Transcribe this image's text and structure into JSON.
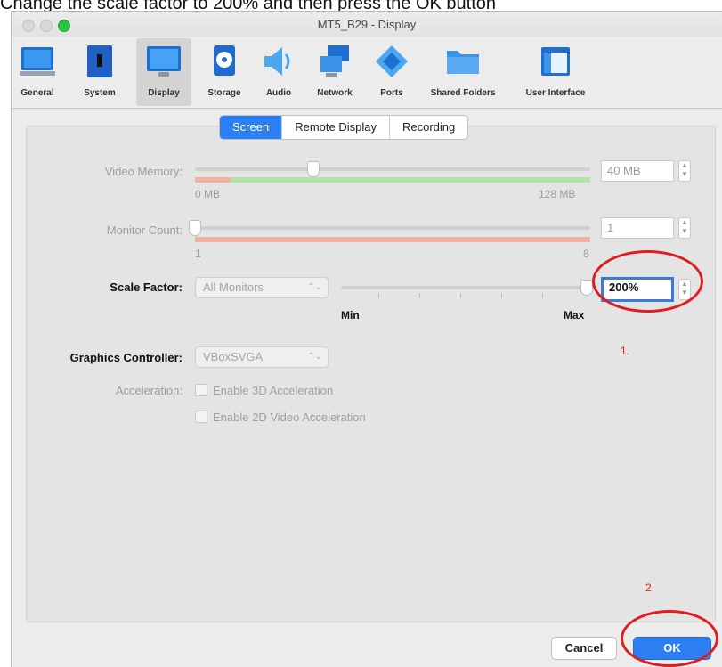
{
  "caption": "Change the scale factor to 200% and then press the OK button",
  "window": {
    "title": "MT5_B29 - Display"
  },
  "toolbar": {
    "items": [
      {
        "label": "General",
        "icon": "general-icon"
      },
      {
        "label": "System",
        "icon": "system-icon"
      },
      {
        "label": "Display",
        "icon": "display-icon",
        "selected": true
      },
      {
        "label": "Storage",
        "icon": "storage-icon"
      },
      {
        "label": "Audio",
        "icon": "audio-icon"
      },
      {
        "label": "Network",
        "icon": "network-icon"
      },
      {
        "label": "Ports",
        "icon": "ports-icon"
      },
      {
        "label": "Shared Folders",
        "icon": "shared-folders-icon"
      },
      {
        "label": "User Interface",
        "icon": "user-interface-icon"
      }
    ]
  },
  "tabs": [
    {
      "label": "Screen",
      "active": true
    },
    {
      "label": "Remote Display"
    },
    {
      "label": "Recording"
    }
  ],
  "video_memory": {
    "label": "Video Memory:",
    "value": "40 MB",
    "min_label": "0 MB",
    "max_label": "128 MB",
    "level": 0.3
  },
  "monitor_count": {
    "label": "Monitor Count:",
    "value": "1",
    "min_label": "1",
    "max_label": "8",
    "level": 0.0
  },
  "scale_factor": {
    "label": "Scale Factor:",
    "monitor_select": "All Monitors",
    "value": "200%",
    "min_label": "Min",
    "max_label": "Max",
    "level": 1.0
  },
  "graphics_controller": {
    "label": "Graphics Controller:",
    "value": "VBoxSVGA"
  },
  "acceleration": {
    "label": "Acceleration:",
    "enable_3d": "Enable 3D Acceleration",
    "enable_2d": "Enable 2D Video Acceleration"
  },
  "annotations": {
    "step1": "1.",
    "step2": "2."
  },
  "buttons": {
    "cancel": "Cancel",
    "ok": "OK"
  },
  "colors": {
    "accent": "#2b7ff3",
    "annotation": "#e01e1e",
    "memory_safe": "#b5e3a5",
    "memory_warn": "#f1b3a1"
  }
}
